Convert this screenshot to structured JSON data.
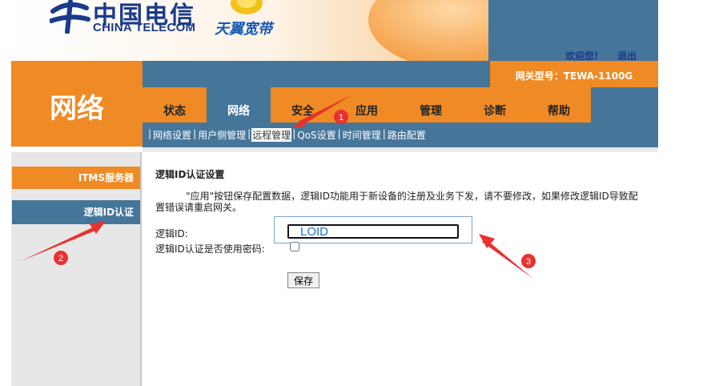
{
  "header": {
    "logo_cn": "中国电信",
    "logo_en": "CHINA TELECOM",
    "brand2": "天翼宽带",
    "welcome": "欢迎您!",
    "logout": "退出",
    "model": "网关型号：TEWA-1100G"
  },
  "section_title": "网络",
  "tabs": [
    {
      "label": "状态"
    },
    {
      "label": "网络"
    },
    {
      "label": "安全"
    },
    {
      "label": "应用"
    },
    {
      "label": "管理"
    },
    {
      "label": "诊断"
    },
    {
      "label": "帮助"
    }
  ],
  "subnav": [
    {
      "label": "网络设置"
    },
    {
      "label": "用户侧管理"
    },
    {
      "label": "远程管理"
    },
    {
      "label": "QoS设置"
    },
    {
      "label": "时间管理"
    },
    {
      "label": "路由配置"
    }
  ],
  "sidebar": {
    "items": [
      {
        "label": "ITMS服务器"
      },
      {
        "label": "逻辑ID认证"
      }
    ]
  },
  "content": {
    "title": "逻辑ID认证设置",
    "description": "          \"应用\"按钮保存配置数据，逻辑ID功能用于新设备的注册及业务下发，请不要修改，如果修改逻辑ID导致配置错误请重启网关。",
    "loid_label": "逻辑ID:",
    "loid_value": "LOID",
    "pw_label": "逻辑ID认证是否使用密码:",
    "save": "保存"
  },
  "annotations": {
    "marker1": "1",
    "marker2": "2",
    "marker3": "3"
  },
  "colors": {
    "orange": "#ef8a25",
    "blue": "#46759a",
    "marker_red": "#e8322f"
  }
}
